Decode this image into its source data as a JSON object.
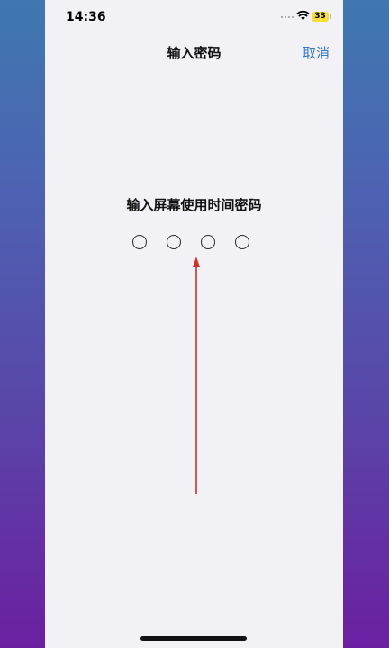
{
  "status_bar": {
    "time": "14:36",
    "battery_level": "33",
    "signal_icon": "signal-dots-icon",
    "wifi_icon": "wifi-icon"
  },
  "nav": {
    "title": "输入密码",
    "cancel_label": "取消"
  },
  "passcode": {
    "prompt": "输入屏幕使用时间密码",
    "digit_count": 4,
    "filled": 0
  },
  "annotation": {
    "arrow_icon": "red-arrow-up-icon",
    "arrow_color": "#d0302a"
  },
  "colors": {
    "accent": "#3478c8",
    "battery": "#f4de3a",
    "screen_bg": "#f2f1f6"
  }
}
